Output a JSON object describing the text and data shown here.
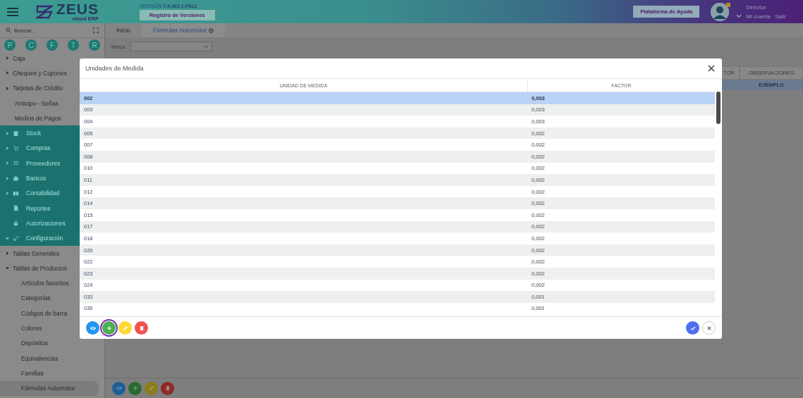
{
  "header": {
    "logo": {
      "name": "ZEUS",
      "tagline": "cloud ERP"
    },
    "version": "VERSIÓN **7.6.483.1-FALL**",
    "changelog_button": "Registro de Versiones",
    "help_button": "Plataforma de Ayuda",
    "user": {
      "role": "Director",
      "account_link": "Mi cuenta",
      "logout_link": "Salir"
    }
  },
  "sidebar": {
    "search": {
      "placeholder": "Buscar..."
    },
    "shortcuts": [
      "P",
      "C",
      "F",
      "T",
      "R"
    ],
    "items": [
      {
        "label": "Caja",
        "kind": "branch",
        "expanded": false
      },
      {
        "label": "Cheques y Cupones",
        "kind": "branch",
        "expanded": false
      },
      {
        "label": "Tarjetas de Crédito",
        "kind": "branch",
        "expanded": false
      },
      {
        "label": "Anticipo - Señas",
        "kind": "leaf"
      },
      {
        "label": "Medios de Pagos",
        "kind": "leaf"
      }
    ],
    "modules": [
      {
        "label": "Stock",
        "kind": "branch",
        "expanded": false
      },
      {
        "label": "Compras",
        "kind": "branch",
        "expanded": false
      },
      {
        "label": "Proveedores",
        "kind": "branch",
        "expanded": false
      },
      {
        "label": "Bancos",
        "kind": "branch",
        "expanded": false
      },
      {
        "label": "Contabilidad",
        "kind": "branch",
        "expanded": false
      },
      {
        "label": "Reportes",
        "kind": "leaf"
      },
      {
        "label": "Autorizaciones",
        "kind": "leaf"
      },
      {
        "label": "Configuración",
        "kind": "branch",
        "expanded": true,
        "children": [
          {
            "label": "Tablas Generales",
            "kind": "branch",
            "expanded": false
          },
          {
            "label": "Tablas de Productos",
            "kind": "branch",
            "expanded": true,
            "children": [
              {
                "label": "Artículos favoritos",
                "selected": false
              },
              {
                "label": "Categorías",
                "selected": false
              },
              {
                "label": "Códigos de barra",
                "selected": false
              },
              {
                "label": "Colores",
                "selected": false
              },
              {
                "label": "Depósitos",
                "selected": false
              },
              {
                "label": "Equivalencias",
                "selected": false
              },
              {
                "label": "Familias",
                "selected": false
              },
              {
                "label": "Fórmulas Automotor",
                "selected": true
              }
            ]
          }
        ]
      }
    ]
  },
  "tabs": [
    {
      "label": "Inicio",
      "selected": false,
      "closable": false
    },
    {
      "label": "Fórmulas Automotor",
      "selected": true,
      "closable": true
    }
  ],
  "filter": {
    "label": "Marca:"
  },
  "background_table": {
    "columns": [
      "TOR",
      "OBSERVACIONES"
    ],
    "rows": [
      {
        "column_2": "EJEMPLO",
        "selected": true
      }
    ]
  },
  "dialog": {
    "title": "Unidades de Medida",
    "columns": [
      "UNIDAD DE MEDIDA",
      "FACTOR"
    ],
    "rows": [
      {
        "unit": "002",
        "factor": "0,003",
        "selected": true
      },
      {
        "unit": "003",
        "factor": "0,003",
        "selected": false
      },
      {
        "unit": "004",
        "factor": "0,003",
        "selected": false
      },
      {
        "unit": "005",
        "factor": "0,002",
        "selected": false
      },
      {
        "unit": "007",
        "factor": "0,002",
        "selected": false
      },
      {
        "unit": "008",
        "factor": "0,002",
        "selected": false
      },
      {
        "unit": "010",
        "factor": "0,002",
        "selected": false
      },
      {
        "unit": "011",
        "factor": "0,002",
        "selected": false
      },
      {
        "unit": "012",
        "factor": "0,002",
        "selected": false
      },
      {
        "unit": "014",
        "factor": "0,002",
        "selected": false
      },
      {
        "unit": "015",
        "factor": "0,002",
        "selected": false
      },
      {
        "unit": "017",
        "factor": "0,002",
        "selected": false
      },
      {
        "unit": "018",
        "factor": "0,002",
        "selected": false
      },
      {
        "unit": "020",
        "factor": "0,002",
        "selected": false
      },
      {
        "unit": "022",
        "factor": "0,002",
        "selected": false
      },
      {
        "unit": "023",
        "factor": "0,002",
        "selected": false
      },
      {
        "unit": "024",
        "factor": "0,002",
        "selected": false
      },
      {
        "unit": "033",
        "factor": "0,001",
        "selected": false
      },
      {
        "unit": "035",
        "factor": "0,001",
        "selected": false
      }
    ],
    "actions": [
      {
        "kind": "view",
        "focused": false
      },
      {
        "kind": "add",
        "focused": true
      },
      {
        "kind": "edit",
        "focused": false
      },
      {
        "kind": "delete",
        "focused": false
      }
    ],
    "confirm_actions": [
      {
        "kind": "confirm"
      },
      {
        "kind": "cancel"
      }
    ]
  },
  "page_actions": [
    {
      "kind": "view"
    },
    {
      "kind": "add"
    },
    {
      "kind": "edit"
    },
    {
      "kind": "delete"
    }
  ]
}
